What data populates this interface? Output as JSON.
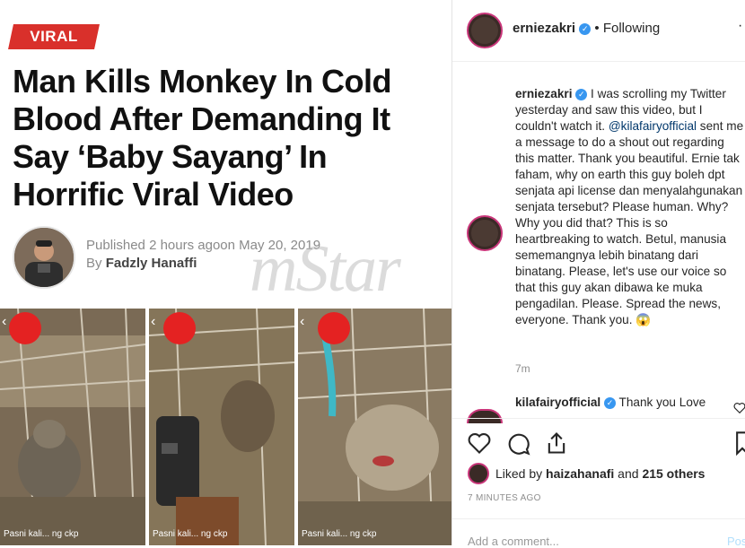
{
  "article": {
    "tag": "VIRAL",
    "headline_lines": [
      "Man Kills Monkey In Cold",
      "Blood After Demanding It",
      "Say ‘Baby Sayang’ In",
      "Horrific Viral Video"
    ],
    "published_prefix": "Published ",
    "published_ago": "2 hours ago",
    "published_on": "on May 20, 2019",
    "by_prefix": "By ",
    "author": "Fadzly Hanaffi",
    "watermark": "mStar"
  },
  "video_frames": [
    {
      "caption": "Pasni kali... ng ckp"
    },
    {
      "caption": "Pasni kali... ng ckp"
    },
    {
      "caption": "Pasni kali... ng ckp"
    }
  ],
  "post": {
    "header_username": "erniezakri",
    "separator": "•",
    "follow_status": "Following",
    "more_icon": "more-dots",
    "caption_username": "erniezakri",
    "caption_part1": " I was scrolling my Twitter yesterday and saw this video, but I couldn't watch it. ",
    "caption_mention": "@kilafairyofficial",
    "caption_part2": " sent me a message to do a shout out regarding this matter. Thank you beautiful. Ernie tak faham, why on earth this guy boleh dpt senjata api license dan menyalahgunakan senjata tersebut? Please human. Why? Why you did that? This is so heartbreaking to watch. Betul, manusia sememangnya lebih binatang dari binatang. Please, let's use our voice so that this guy akan dibawa ke muka pengadilan. Please. Spread the news, everyone. Thank you. 😱",
    "caption_time": "7m",
    "comment_username": "kilafairyofficial",
    "comment_text": " Thank you Love",
    "likes_prefix": "Liked by ",
    "likes_user": "haizahanafi",
    "likes_mid": " and ",
    "likes_count": "215 others",
    "timestamp": "7 MINUTES AGO",
    "add_comment_placeholder": "Add a comment...",
    "post_button": "Post"
  },
  "colors": {
    "tag_red": "#d9302b",
    "verified_blue": "#3897f0",
    "mention_blue": "#00376b",
    "story_ring": "#c9367a"
  }
}
